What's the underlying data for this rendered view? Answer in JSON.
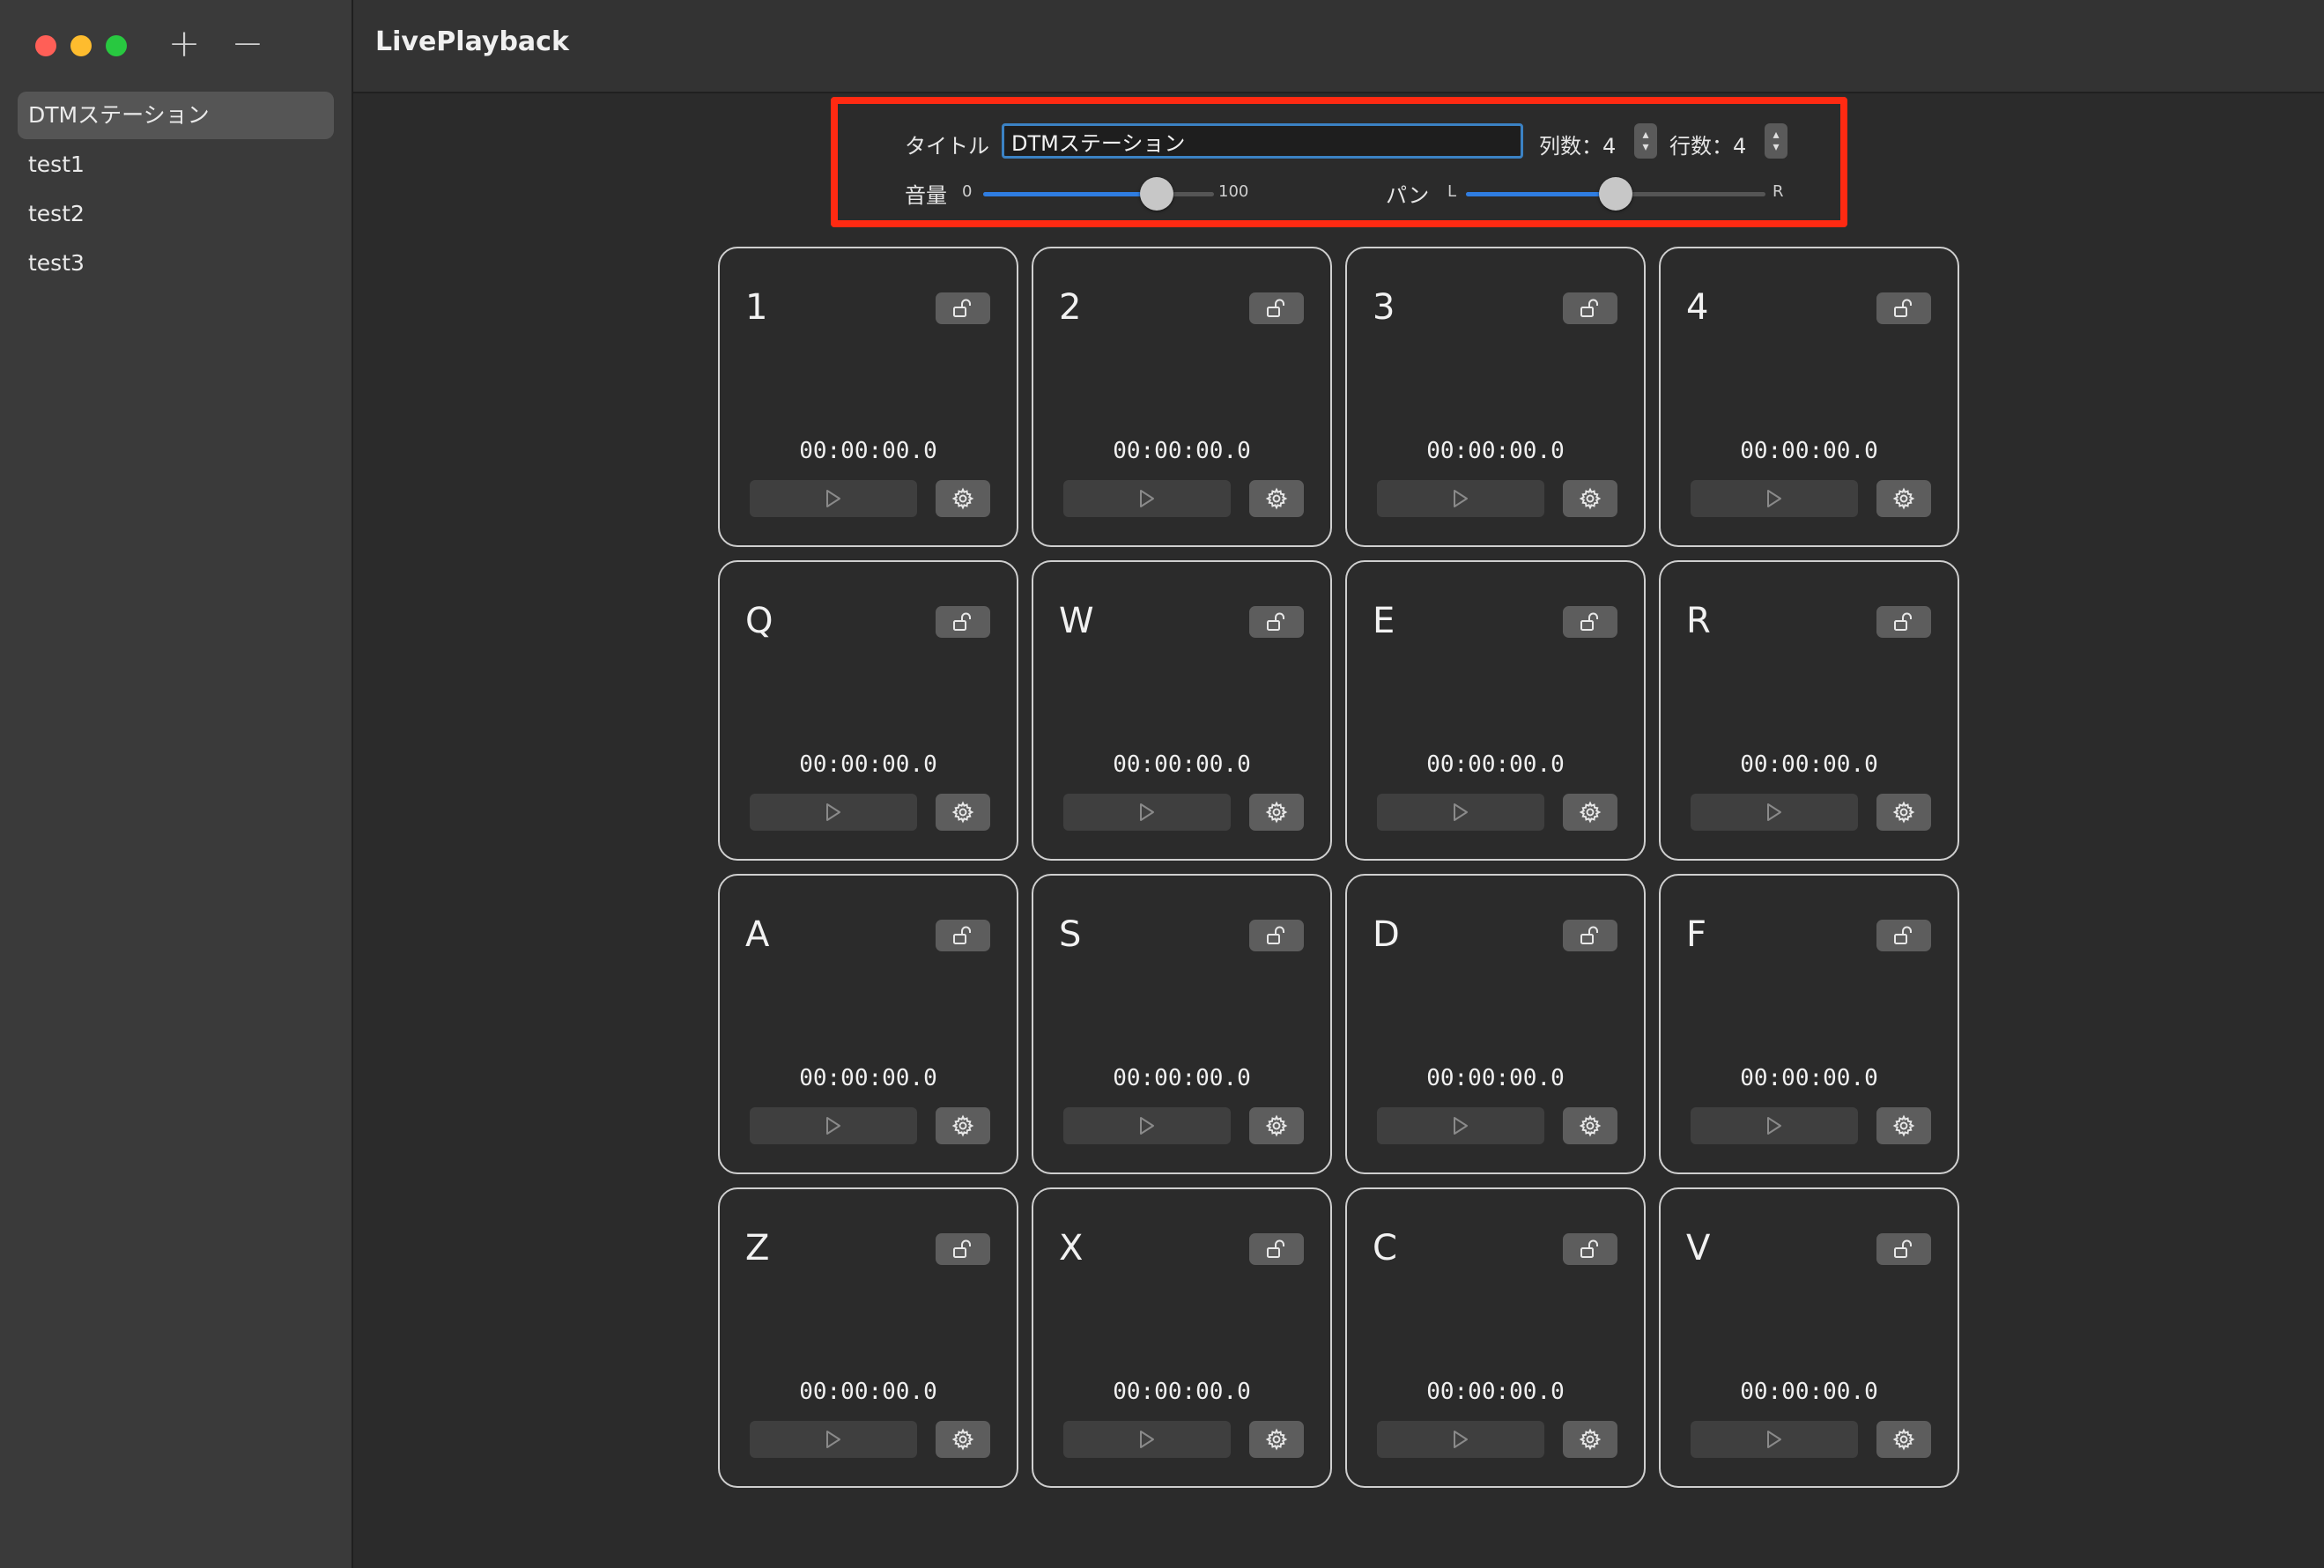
{
  "app": {
    "title": "LivePlayback"
  },
  "sidebar": {
    "add_label": "+",
    "remove_label": "−",
    "items": [
      {
        "label": "DTMステーション",
        "selected": true
      },
      {
        "label": "test1",
        "selected": false
      },
      {
        "label": "test2",
        "selected": false
      },
      {
        "label": "test3",
        "selected": false
      }
    ]
  },
  "controls": {
    "title_label": "タイトル",
    "title_value": "DTMステーション",
    "columns_label": "列数：4",
    "rows_label": "行数：4",
    "volume_label": "音量",
    "volume_min": "0",
    "volume_max": "100",
    "volume_value": 75,
    "pan_label": "パン",
    "pan_left": "L",
    "pan_right": "R",
    "pan_value": 0.5
  },
  "pads": [
    {
      "key": "1",
      "time": "00:00:00.0"
    },
    {
      "key": "2",
      "time": "00:00:00.0"
    },
    {
      "key": "3",
      "time": "00:00:00.0"
    },
    {
      "key": "4",
      "time": "00:00:00.0"
    },
    {
      "key": "Q",
      "time": "00:00:00.0"
    },
    {
      "key": "W",
      "time": "00:00:00.0"
    },
    {
      "key": "E",
      "time": "00:00:00.0"
    },
    {
      "key": "R",
      "time": "00:00:00.0"
    },
    {
      "key": "A",
      "time": "00:00:00.0"
    },
    {
      "key": "S",
      "time": "00:00:00.0"
    },
    {
      "key": "D",
      "time": "00:00:00.0"
    },
    {
      "key": "F",
      "time": "00:00:00.0"
    },
    {
      "key": "Z",
      "time": "00:00:00.0"
    },
    {
      "key": "X",
      "time": "00:00:00.0"
    },
    {
      "key": "C",
      "time": "00:00:00.0"
    },
    {
      "key": "V",
      "time": "00:00:00.0"
    }
  ],
  "icons": {
    "lock": "unlock-icon",
    "play": "play-icon",
    "gear": "gear-icon"
  },
  "colors": {
    "accent": "#2f7de1",
    "highlight_frame": "#ff2a12"
  }
}
